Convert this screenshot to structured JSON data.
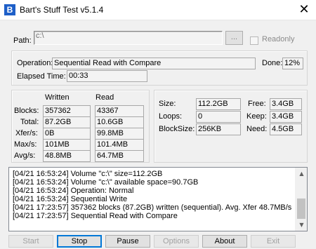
{
  "window": {
    "title": "Bart's Stuff Test v5.1.4",
    "icon_letter": "B",
    "close_glyph": "✕"
  },
  "path": {
    "label": "Path:",
    "value": "c:\\",
    "browse_label": "...",
    "readonly_label": "Readonly",
    "readonly_checked": false
  },
  "status": {
    "operation_label": "Operation:",
    "operation_value": "Sequential Read with Compare",
    "done_label": "Done:",
    "done_value": "12%",
    "elapsed_label": "Elapsed Time:",
    "elapsed_value": "00:33"
  },
  "stats": {
    "written_header": "Written",
    "read_header": "Read",
    "rows": [
      {
        "label": "Blocks:",
        "written": "357362",
        "read": "43367"
      },
      {
        "label": "Total:",
        "written": "87.2GB",
        "read": "10.6GB"
      },
      {
        "label": "Xfer/s:",
        "written": "0B",
        "read": "99.8MB"
      },
      {
        "label": "Max/s:",
        "written": "101MB",
        "read": "101.4MB"
      },
      {
        "label": "Avg/s:",
        "written": "48.8MB",
        "read": "64.7MB"
      }
    ]
  },
  "info": {
    "size_label": "Size:",
    "size_value": "112.2GB",
    "loops_label": "Loops:",
    "loops_value": "0",
    "blocksize_label": "BlockSize:",
    "blocksize_value": "256KB",
    "free_label": "Free:",
    "free_value": "3.4GB",
    "keep_label": "Keep:",
    "keep_value": "3.4GB",
    "need_label": "Need:",
    "need_value": "4.5GB"
  },
  "log": [
    "[04/21 16:53:24] Volume \"c:\\\" size=112.2GB",
    "[04/21 16:53:24] Volume \"c:\\\" available space=90.7GB",
    "[04/21 16:53:24] Operation: Normal",
    "[04/21 16:53:24] Sequential Write",
    "[04/21 17:23:57] 357362 blocks (87.2GB) written (sequential). Avg. Xfer 48.7MB/s",
    "[04/21 17:23:57] Sequential Read with Compare"
  ],
  "buttons": {
    "start": "Start",
    "stop": "Stop",
    "pause": "Pause",
    "options": "Options",
    "about": "About",
    "exit": "Exit"
  }
}
